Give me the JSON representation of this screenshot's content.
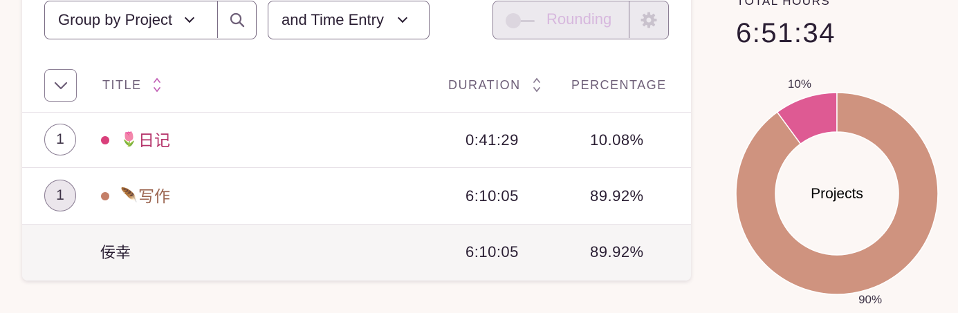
{
  "toolbar": {
    "group_select": "Group by Project",
    "sub_select": "and Time Entry",
    "rounding_label": "Rounding"
  },
  "table": {
    "columns": [
      "TITLE",
      "DURATION",
      "PERCENTAGE"
    ],
    "rows": [
      {
        "count": "1",
        "emoji": "🌷",
        "name": "日记",
        "dot_color": "#d9407b",
        "name_color": "#b5336a",
        "duration": "0:41:29",
        "percentage": "10.08%"
      },
      {
        "count": "1",
        "emoji": "🪶",
        "name": "写作",
        "dot_color": "#c47f68",
        "name_color": "#9c6651",
        "duration": "6:10:05",
        "percentage": "89.92%"
      }
    ],
    "subrow": {
      "name": "佞幸",
      "duration": "6:10:05",
      "percentage": "89.92%"
    }
  },
  "summary": {
    "title": "TOTAL HOURS",
    "total": "6:51:34"
  },
  "chart_data": {
    "type": "pie",
    "donut": true,
    "center_label": "Projects",
    "slices": [
      {
        "value": 10.08,
        "label": "10%",
        "color": "#de5a93"
      },
      {
        "value": 89.92,
        "label": "90%",
        "color": "#cf937f"
      }
    ]
  },
  "colors": {
    "accent": "#6e5f78",
    "rounding_text": "#d7b8de"
  }
}
